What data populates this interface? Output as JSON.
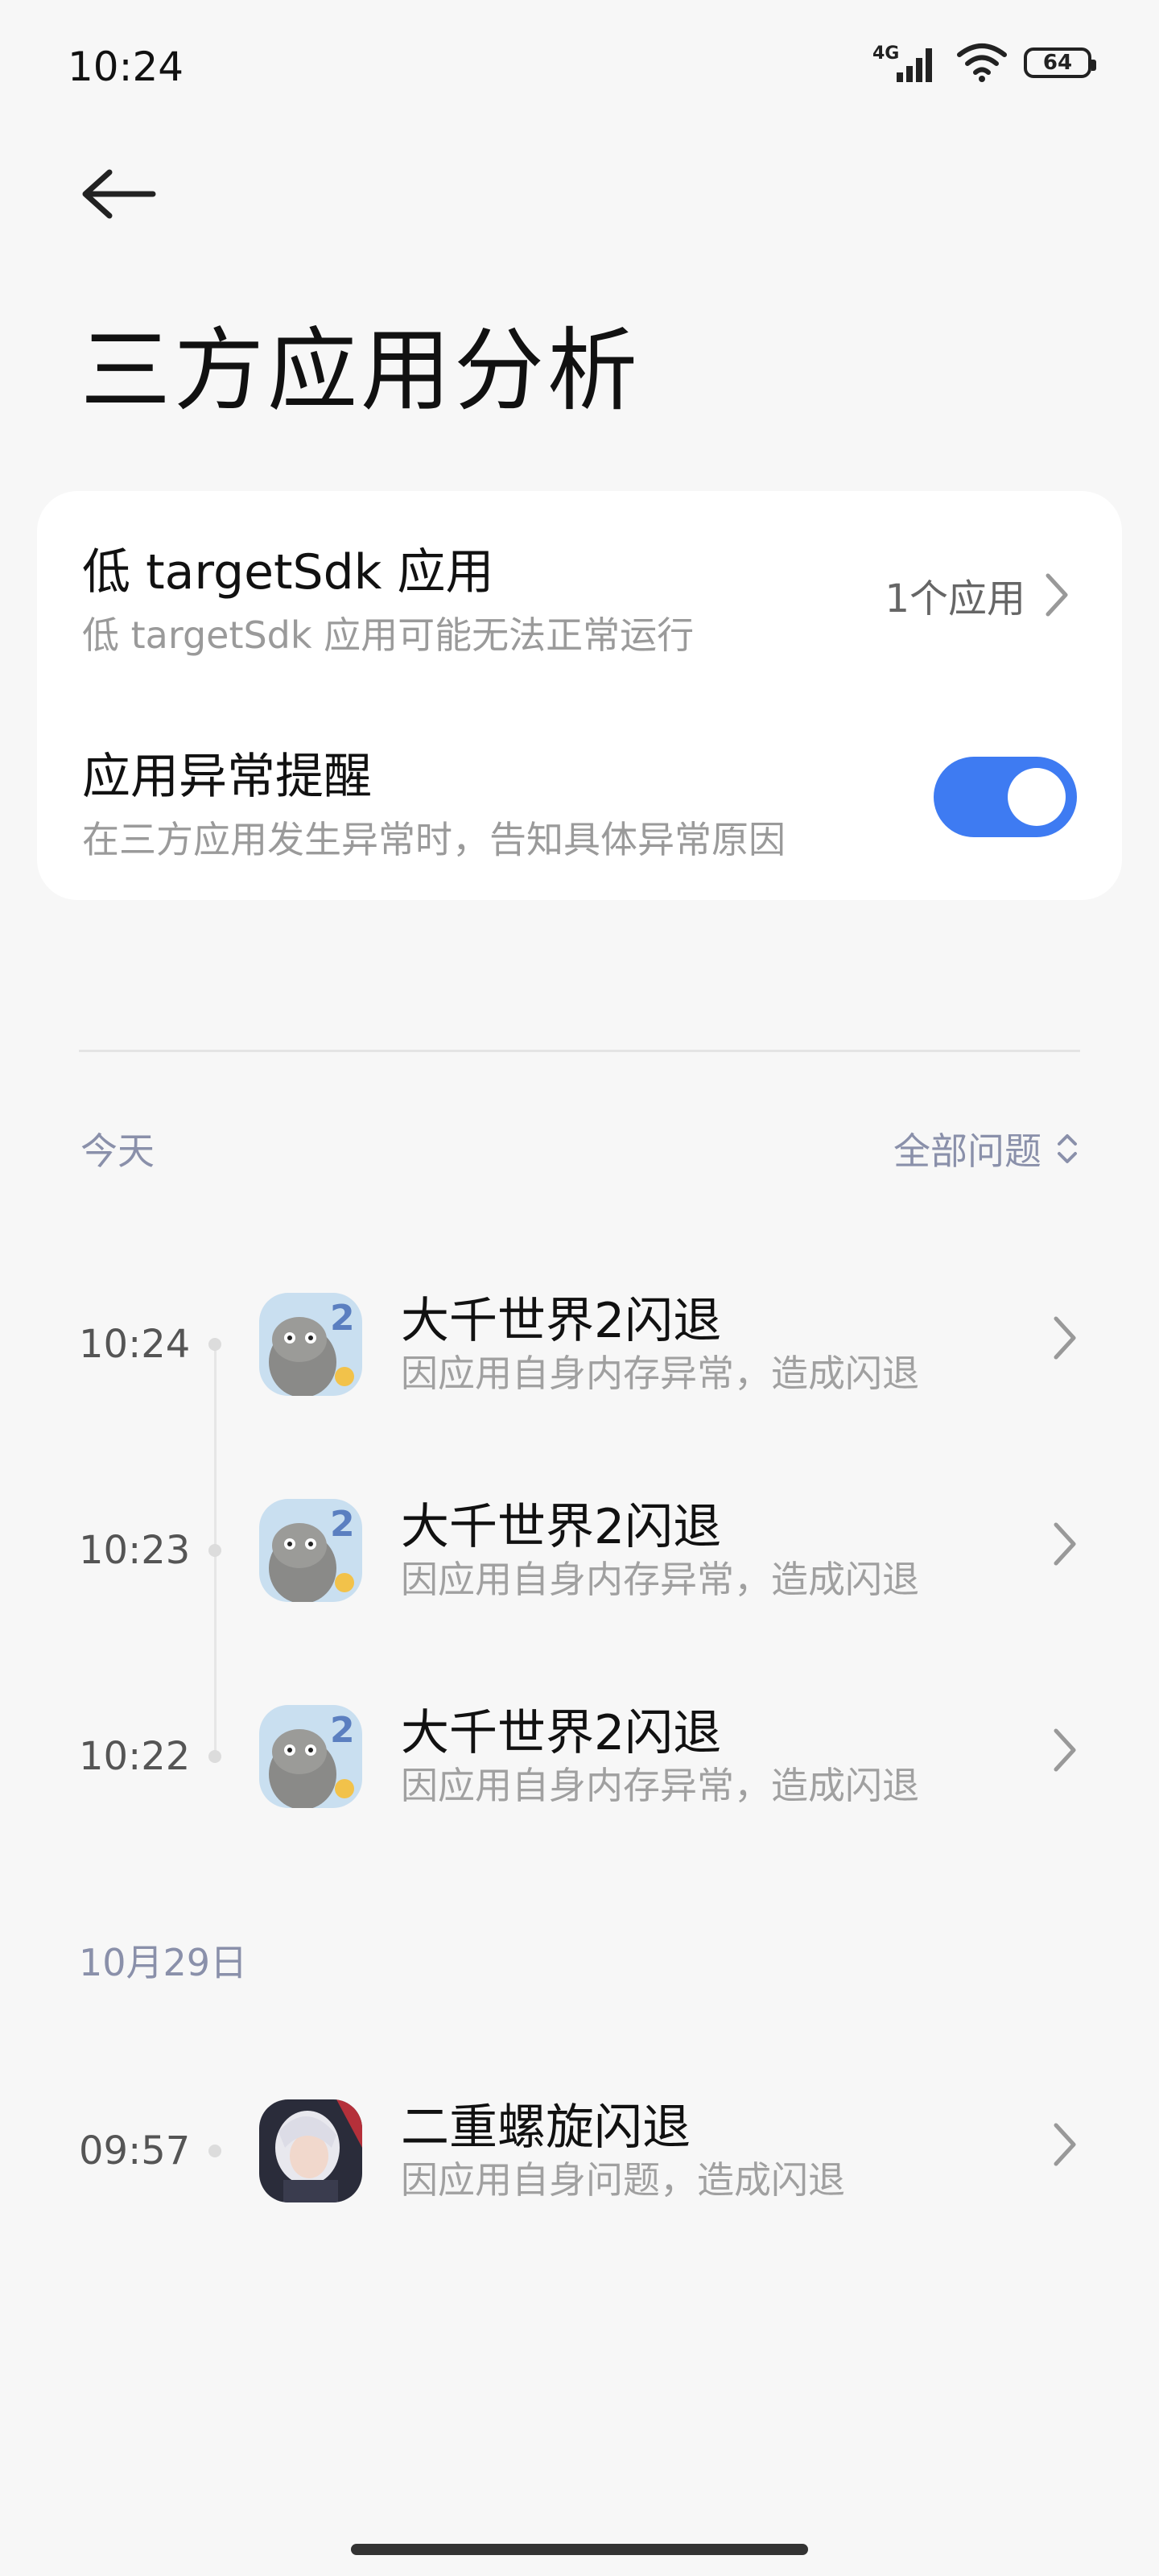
{
  "status_bar": {
    "time": "10:24",
    "network": "4G",
    "battery": "64"
  },
  "header": {
    "title": "三方应用分析"
  },
  "settings": {
    "low_target": {
      "title": "低 targetSdk 应用",
      "subtitle": "低 targetSdk 应用可能无法正常运行",
      "value": "1个应用"
    },
    "anomaly_reminder": {
      "title": "应用异常提醒",
      "subtitle": "在三方应用发生异常时，告知具体异常原因",
      "enabled": true
    }
  },
  "filter": {
    "label": "全部问题"
  },
  "groups": [
    {
      "date": "今天",
      "items": [
        {
          "time": "10:24",
          "title": "大千世界2闪退",
          "subtitle": "因应用自身内存异常，造成闪退",
          "icon": "cat-app-icon"
        },
        {
          "time": "10:23",
          "title": "大千世界2闪退",
          "subtitle": "因应用自身内存异常，造成闪退",
          "icon": "cat-app-icon"
        },
        {
          "time": "10:22",
          "title": "大千世界2闪退",
          "subtitle": "因应用自身内存异常，造成闪退",
          "icon": "cat-app-icon"
        }
      ]
    },
    {
      "date": "10月29日",
      "items": [
        {
          "time": "09:57",
          "title": "二重螺旋闪退",
          "subtitle": "因应用自身问题，造成闪退",
          "icon": "anime-character-app-icon"
        }
      ]
    }
  ],
  "colors": {
    "accent": "#3e7bf2",
    "background": "#f7f7f7",
    "section_text": "#8a90aa"
  }
}
